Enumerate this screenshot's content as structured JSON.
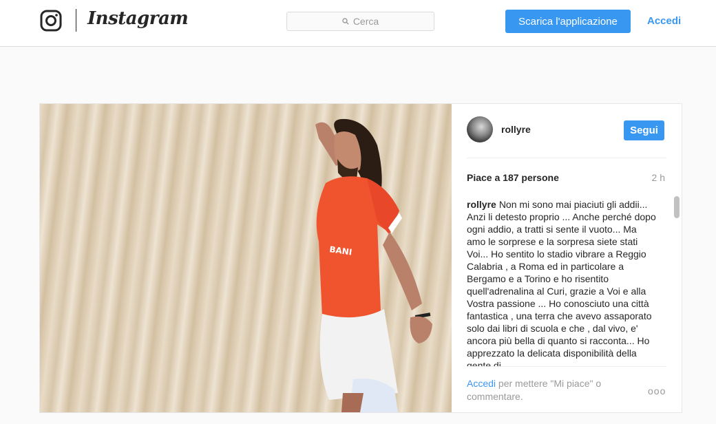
{
  "header": {
    "wordmark": "Instagram",
    "search_placeholder": "Cerca",
    "download_button": "Scarica l'applicazione",
    "login_link": "Accedi"
  },
  "post": {
    "username": "rollyre",
    "follow_button": "Segui",
    "likes": "Piace a 187 persone",
    "time": "2 h",
    "caption_user": "rollyre",
    "caption_text": "Non mi sono mai piaciuti gli addii... Anzi li detesto proprio ... Anche perché dopo ogni addio, a tratti si sente il vuoto... Ma amo le sorprese e la sorpresa siete stati Voi... Ho sentito lo stadio vibrare a Reggio Calabria , a Roma ed in particolare a Bergamo e a Torino e ho risentito quell'adrenalina al Curi, grazie a Voi e alla Vostra passione ... Ho conosciuto una città fantastica , una terra che avevo assaporato solo dai libri di scuola e che , dal vivo, e' ancora più bella di quanto si racconta... Ho apprezzato la delicata disponibilità della gente di",
    "comment_login": "Accedi",
    "comment_prompt": " per mettere \"Mi piace\" o commentare.",
    "more_glyph": "ooo"
  },
  "icons": {
    "logo": "instagram-camera-icon",
    "search": "search-icon",
    "more": "more-options-icon"
  },
  "colors": {
    "accent": "#3897f0",
    "jersey": "#f0542e"
  }
}
